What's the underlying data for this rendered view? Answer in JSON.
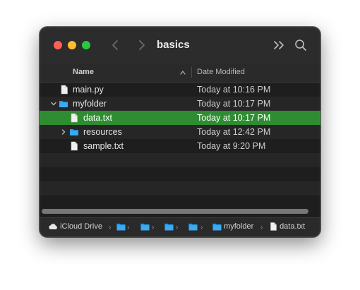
{
  "window": {
    "title": "basics"
  },
  "toolbar": {
    "back_icon": "chevron-left-icon",
    "forward_icon": "chevron-right-icon",
    "more_icon": "double-chevron-icon",
    "search_icon": "magnifier-icon"
  },
  "columns": {
    "name": "Name",
    "date": "Date Modified"
  },
  "files": [
    {
      "name": "main.py",
      "date": "Today at 10:16 PM",
      "kind": "file",
      "indent": 0
    },
    {
      "name": "myfolder",
      "date": "Today at 10:17 PM",
      "kind": "folder",
      "indent": 0,
      "expanded": true
    },
    {
      "name": "data.txt",
      "date": "Today at 10:17 PM",
      "kind": "file",
      "indent": 1,
      "selected": true
    },
    {
      "name": "resources",
      "date": "Today at 12:42 PM",
      "kind": "folder",
      "indent": 1,
      "expanded": false
    },
    {
      "name": "sample.txt",
      "date": "Today at 9:20 PM",
      "kind": "file",
      "indent": 1
    }
  ],
  "pathbar": {
    "root": "iCloud Drive",
    "folder": "myfolder",
    "file": "data.txt"
  },
  "colors": {
    "selection": "#2f8d31",
    "folder": "#1e9bf0",
    "window": "#1e1e1e"
  }
}
